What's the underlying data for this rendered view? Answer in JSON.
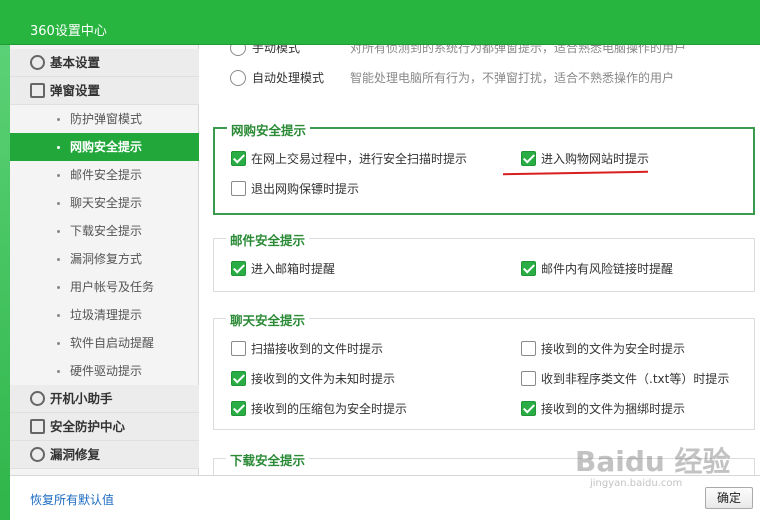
{
  "window": {
    "title": "360设置中心"
  },
  "sidebar": {
    "groups": [
      {
        "label": "基本设置"
      },
      {
        "label": "弹窗设置"
      },
      {
        "label": "开机小助手"
      },
      {
        "label": "安全防护中心"
      },
      {
        "label": "漏洞修复"
      }
    ],
    "subitems": [
      {
        "label": "防护弹窗模式"
      },
      {
        "label": "网购安全提示",
        "active": true
      },
      {
        "label": "邮件安全提示"
      },
      {
        "label": "聊天安全提示"
      },
      {
        "label": "下载安全提示"
      },
      {
        "label": "漏洞修复方式"
      },
      {
        "label": "用户帐号及任务"
      },
      {
        "label": "垃圾清理提示"
      },
      {
        "label": "软件自启动提醒"
      },
      {
        "label": "硬件驱动提示"
      }
    ]
  },
  "popup_mode": {
    "manual": {
      "label": "手动模式",
      "desc": "对所有侦测到的系统行为都弹窗提示，适合熟悉电脑操作的用户"
    },
    "auto": {
      "label": "自动处理模式",
      "desc": "智能处理电脑所有行为，不弹窗打扰，适合不熟悉操作的用户"
    }
  },
  "sections": {
    "shopping": {
      "title": "网购安全提示",
      "options": [
        {
          "label": "在网上交易过程中，进行安全扫描时提示",
          "checked": true
        },
        {
          "label": "进入购物网站时提示",
          "checked": true
        },
        {
          "label": "退出网购保镖时提示",
          "checked": false
        }
      ]
    },
    "mail": {
      "title": "邮件安全提示",
      "options": [
        {
          "label": "进入邮箱时提醒",
          "checked": true
        },
        {
          "label": "邮件内有风险链接时提醒",
          "checked": true
        }
      ]
    },
    "chat": {
      "title": "聊天安全提示",
      "options": [
        {
          "label": "扫描接收到的文件时提示",
          "checked": false
        },
        {
          "label": "接收到的文件为安全时提示",
          "checked": false
        },
        {
          "label": "接收到的文件为未知时提示",
          "checked": true
        },
        {
          "label": "收到非程序类文件（.txt等）时提示",
          "checked": false
        },
        {
          "label": "接收到的压缩包为安全时提示",
          "checked": true
        },
        {
          "label": "接收到的文件为捆绑时提示",
          "checked": true
        }
      ]
    },
    "download": {
      "title": "下载安全提示"
    }
  },
  "footer": {
    "restore": "恢复所有默认值",
    "ok": "确定"
  },
  "watermark": {
    "main": "Baidu 经验",
    "sub": "jingyan.baidu.com"
  },
  "colors": {
    "brand_green": "#27b43f",
    "active_item": "#22a83a",
    "annotation_red": "#d81e1e"
  }
}
